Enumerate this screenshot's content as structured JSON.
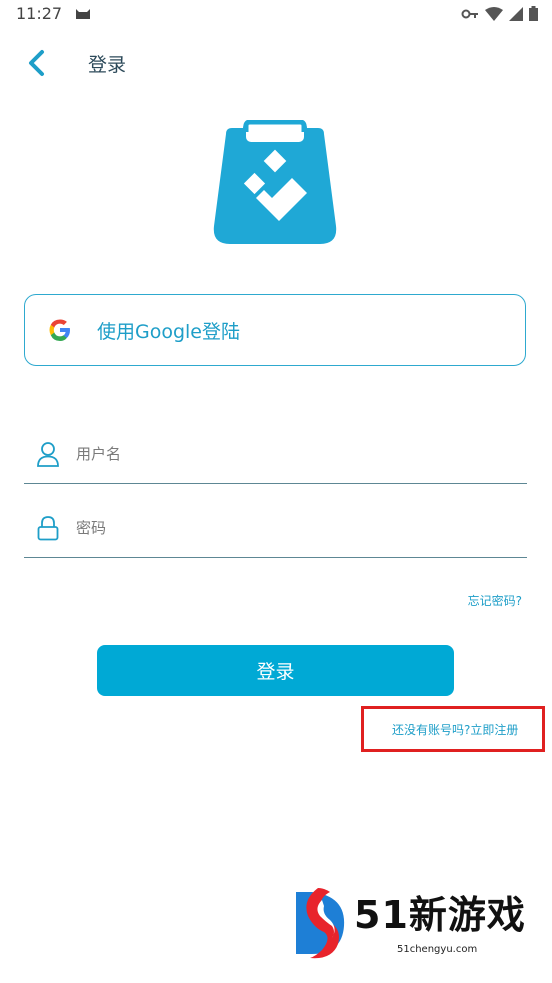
{
  "status_bar": {
    "time": "11:27",
    "icons": [
      "cat-icon",
      "key-icon",
      "wifi-icon",
      "signal-icon",
      "battery-icon"
    ]
  },
  "app_bar": {
    "back_icon": "chevron-left-icon",
    "title": "登录"
  },
  "google_button": {
    "label": "使用Google登陆",
    "icon": "google-icon"
  },
  "form": {
    "username_placeholder": "用户名",
    "password_placeholder": "密码",
    "forgot_password": "忘记密码?",
    "login_button": "登录",
    "register_link": "还没有账号吗?立即注册"
  },
  "watermark": {
    "brand": "51新游戏",
    "url": "51chengyu.com"
  },
  "colors": {
    "accent": "#00a9d5",
    "highlight_box": "#e02020"
  }
}
